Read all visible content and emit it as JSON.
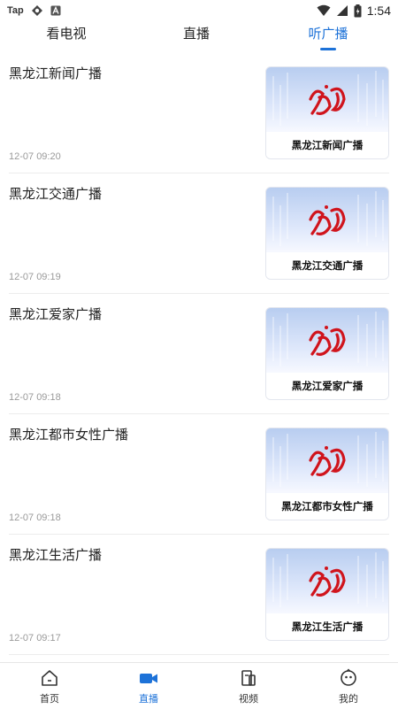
{
  "status_bar": {
    "carrier": "Tap",
    "time": "1:54"
  },
  "tabs": [
    {
      "label": "看电视"
    },
    {
      "label": "直播"
    },
    {
      "label": "听广播",
      "active": true
    }
  ],
  "items": [
    {
      "title": "黑龙江新闻广播",
      "time": "12-07 09:20",
      "thumb_label": "黑龙江新闻广播"
    },
    {
      "title": "黑龙江交通广播",
      "time": "12-07 09:19",
      "thumb_label": "黑龙江交通广播"
    },
    {
      "title": "黑龙江爱家广播",
      "time": "12-07 09:18",
      "thumb_label": "黑龙江爱家广播"
    },
    {
      "title": "黑龙江都市女性广播",
      "time": "12-07 09:18",
      "thumb_label": "黑龙江都市女性广播"
    },
    {
      "title": "黑龙江生活广播",
      "time": "12-07 09:17",
      "thumb_label": "黑龙江生活广播"
    }
  ],
  "bottom_nav": [
    {
      "label": "首页",
      "icon": "home-icon"
    },
    {
      "label": "直播",
      "icon": "video-camera-icon",
      "active": true
    },
    {
      "label": "视频",
      "icon": "document-icon"
    },
    {
      "label": "我的",
      "icon": "profile-face-icon"
    }
  ],
  "colors": {
    "accent": "#1d72d8",
    "logo_red": "#d0141c"
  }
}
